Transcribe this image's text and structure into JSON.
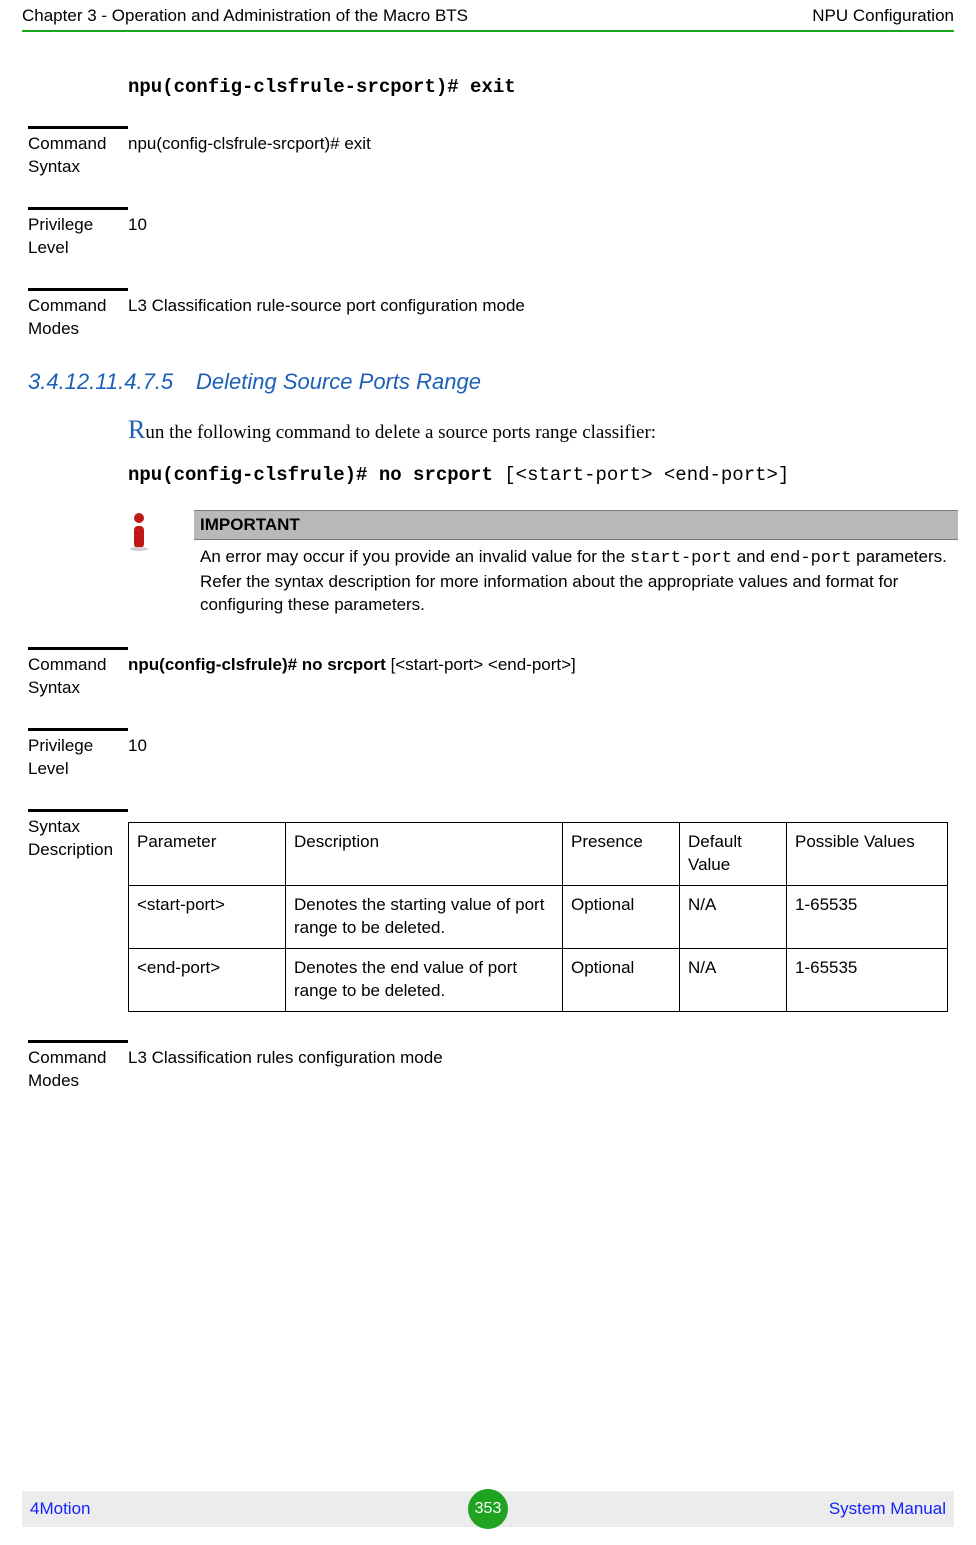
{
  "header": {
    "left": "Chapter 3 - Operation and Administration of the Macro BTS",
    "right": "NPU Configuration"
  },
  "block1": {
    "code": "npu(config-clsfrule-srcport)# exit",
    "cmdSyntaxLabel": "Command Syntax",
    "cmdSyntaxValue": "npu(config-clsfrule-srcport)# exit",
    "privLabel": "Privilege Level",
    "privValue": "10",
    "modesLabel": "Command Modes",
    "modesValue": "L3 Classification rule-source port configuration mode"
  },
  "section": {
    "num": "3.4.12.11.4.7.5",
    "title": "Deleting Source Ports Range"
  },
  "para": {
    "first": "R",
    "rest": "un the following command to delete a source ports range classifier:"
  },
  "block2": {
    "codeBold": "npu(config-clsfrule)# no srcport",
    "codeRest": " [<start-port> <end-port>]"
  },
  "callout": {
    "title": "IMPORTANT",
    "pre": "An error may occur if you provide an invalid value for the ",
    "term1": "start-port",
    "mid": " and ",
    "term2": "end-port",
    "post": " parameters. Refer the syntax description for more information about the appropriate values and format for configuring these parameters."
  },
  "def2": {
    "cmdSyntaxLabel": "Command Syntax",
    "cmdSyntaxBold": "npu(config-clsfrule)# no srcport",
    "cmdSyntaxRest": " [<start-port> <end-port>]",
    "privLabel": "Privilege Level",
    "privValue": "10",
    "syntaxLabel": "Syntax Description",
    "modesLabel": "Command Modes",
    "modesValue": "L3 Classification rules configuration mode"
  },
  "table": {
    "headers": [
      "Parameter",
      "Description",
      "Presence",
      "Default Value",
      "Possible Values"
    ],
    "rows": [
      {
        "param": "<start-port>",
        "desc": "Denotes the starting value of port range to be deleted.",
        "pres": "Optional",
        "def": "N/A",
        "vals": "1-65535"
      },
      {
        "param": "<end-port>",
        "desc": "Denotes the end value of port range to be deleted.",
        "pres": "Optional",
        "def": "N/A",
        "vals": "1-65535"
      }
    ]
  },
  "footer": {
    "left": "4Motion",
    "page": "353",
    "right": "System Manual"
  }
}
